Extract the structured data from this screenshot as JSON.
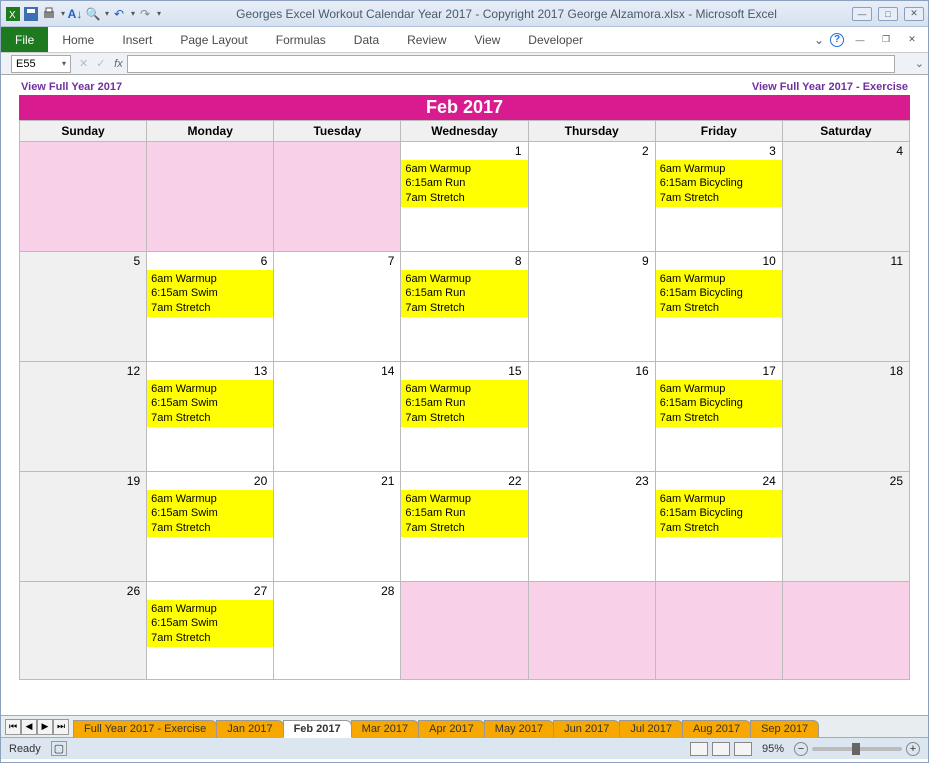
{
  "window": {
    "title": "Georges Excel Workout Calendar Year 2017  -  Copyright 2017 George Alzamora.xlsx  -  Microsoft Excel"
  },
  "ribbon": {
    "file": "File",
    "tabs": [
      "Home",
      "Insert",
      "Page Layout",
      "Formulas",
      "Data",
      "Review",
      "View",
      "Developer"
    ]
  },
  "namebox": "E55",
  "links": {
    "left": "View Full Year 2017",
    "right": "View Full Year 2017 - Exercise"
  },
  "monthTitle": "Feb 2017",
  "dayHeaders": [
    "Sunday",
    "Monday",
    "Tuesday",
    "Wednesday",
    "Thursday",
    "Friday",
    "Saturday"
  ],
  "eventsMon": [
    "6am Warmup",
    "6:15am Swim",
    "7am Stretch"
  ],
  "eventsWed": [
    "6am Warmup",
    "6:15am Run",
    "7am Stretch"
  ],
  "eventsFri": [
    "6am Warmup",
    "6:15am Bicycling",
    "7am Stretch"
  ],
  "weeks": [
    [
      {
        "n": "",
        "cls": "pink"
      },
      {
        "n": "",
        "cls": "pink"
      },
      {
        "n": "",
        "cls": "pink"
      },
      {
        "n": "1",
        "ev": "wed"
      },
      {
        "n": "2"
      },
      {
        "n": "3",
        "ev": "fri"
      },
      {
        "n": "4",
        "cls": "grey"
      }
    ],
    [
      {
        "n": "5",
        "cls": "grey"
      },
      {
        "n": "6",
        "ev": "mon"
      },
      {
        "n": "7"
      },
      {
        "n": "8",
        "ev": "wed"
      },
      {
        "n": "9"
      },
      {
        "n": "10",
        "ev": "fri"
      },
      {
        "n": "11",
        "cls": "grey"
      }
    ],
    [
      {
        "n": "12",
        "cls": "grey"
      },
      {
        "n": "13",
        "ev": "mon"
      },
      {
        "n": "14"
      },
      {
        "n": "15",
        "ev": "wed"
      },
      {
        "n": "16"
      },
      {
        "n": "17",
        "ev": "fri"
      },
      {
        "n": "18",
        "cls": "grey"
      }
    ],
    [
      {
        "n": "19",
        "cls": "grey"
      },
      {
        "n": "20",
        "ev": "mon"
      },
      {
        "n": "21"
      },
      {
        "n": "22",
        "ev": "wed"
      },
      {
        "n": "23"
      },
      {
        "n": "24",
        "ev": "fri"
      },
      {
        "n": "25",
        "cls": "grey"
      }
    ],
    [
      {
        "n": "26",
        "cls": "grey"
      },
      {
        "n": "27",
        "ev": "mon"
      },
      {
        "n": "28"
      },
      {
        "n": "",
        "cls": "pink"
      },
      {
        "n": "",
        "cls": "pink"
      },
      {
        "n": "",
        "cls": "pink"
      },
      {
        "n": "",
        "cls": "pink"
      }
    ]
  ],
  "sheetTabs": [
    "Full Year 2017 - Exercise",
    "Jan 2017",
    "Feb 2017",
    "Mar 2017",
    "Apr 2017",
    "May 2017",
    "Jun 2017",
    "Jul 2017",
    "Aug 2017",
    "Sep 2017"
  ],
  "activeTab": "Feb 2017",
  "status": {
    "ready": "Ready",
    "zoom": "95%"
  }
}
